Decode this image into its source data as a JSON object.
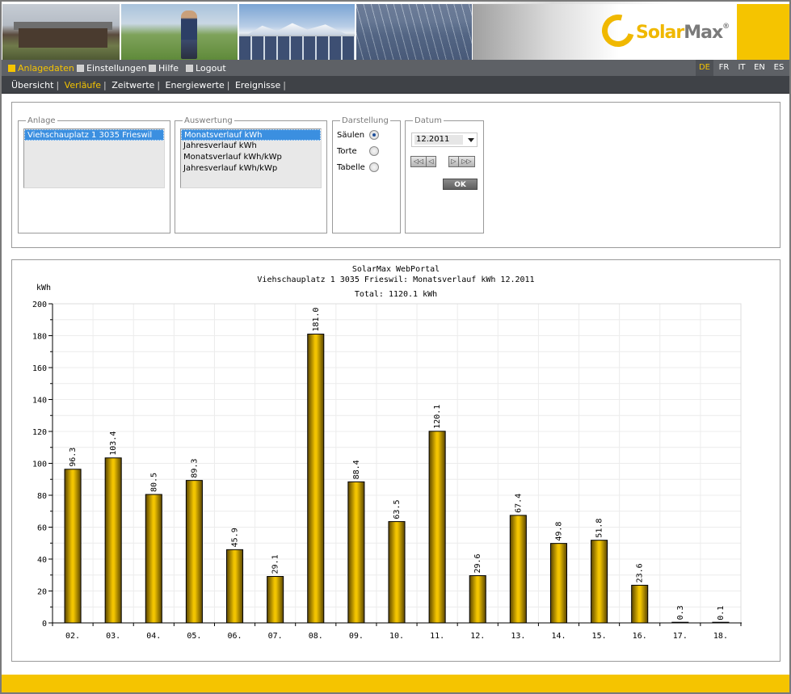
{
  "nav": {
    "main": [
      {
        "label": "Anlagedaten",
        "active": true
      },
      {
        "label": "Einstellungen",
        "active": false
      },
      {
        "label": "Hilfe",
        "active": false
      },
      {
        "label": "Logout",
        "active": false
      }
    ],
    "languages": [
      {
        "label": "DE",
        "active": true
      },
      {
        "label": "FR",
        "active": false
      },
      {
        "label": "IT",
        "active": false
      },
      {
        "label": "EN",
        "active": false
      },
      {
        "label": "ES",
        "active": false
      }
    ],
    "sub": [
      {
        "label": "Übersicht",
        "active": false
      },
      {
        "label": "Verläufe",
        "active": true
      },
      {
        "label": "Zeitwerte",
        "active": false
      },
      {
        "label": "Energiewerte",
        "active": false
      },
      {
        "label": "Ereignisse",
        "active": false
      }
    ]
  },
  "logo": {
    "brand_a": "Solar",
    "brand_b": "Max",
    "reg": "®"
  },
  "form": {
    "anlage": {
      "legend": "Anlage",
      "options": [
        "Viehschauplatz 1 3035 Frieswil"
      ],
      "selected": 0
    },
    "auswertung": {
      "legend": "Auswertung",
      "options": [
        "Monatsverlauf kWh",
        "Jahresverlauf kWh",
        "Monatsverlauf kWh/kWp",
        "Jahresverlauf kWh/kWp"
      ],
      "selected": 0
    },
    "darstellung": {
      "legend": "Darstellung",
      "options": [
        "Säulen",
        "Torte",
        "Tabelle"
      ],
      "selected": 0
    },
    "datum": {
      "legend": "Datum",
      "value": "12.2011",
      "first_label": "◁◁",
      "prev_label": "◁",
      "next_label": "▷",
      "last_label": "▷▷",
      "ok_label": "OK"
    }
  },
  "chart_data": {
    "type": "bar",
    "title": "SolarMax WebPortal",
    "subtitle": "Viehschauplatz 1 3035 Frieswil: Monatsverlauf kWh 12.2011",
    "total": "Total: 1120.1 kWh",
    "ylabel": "kWh",
    "xlabel": "",
    "ylim": [
      0,
      200
    ],
    "yticks": [
      0,
      20,
      40,
      60,
      80,
      100,
      120,
      140,
      160,
      180,
      200
    ],
    "grid": true,
    "categories": [
      "02.",
      "03.",
      "04.",
      "05.",
      "06.",
      "07.",
      "08.",
      "09.",
      "10.",
      "11.",
      "12.",
      "13.",
      "14.",
      "15.",
      "16.",
      "17.",
      "18."
    ],
    "values": [
      96.3,
      103.4,
      80.5,
      89.3,
      45.9,
      29.1,
      181.0,
      88.4,
      63.5,
      120.1,
      29.6,
      67.4,
      49.8,
      51.8,
      23.6,
      0.3,
      0.1
    ],
    "value_labels": [
      "96.3",
      "103.4",
      "80.5",
      "89.3",
      "45.9",
      "29.1",
      "181.0",
      "88.4",
      "63.5",
      "120.1",
      "29.6",
      "67.4",
      "49.8",
      "51.8",
      "23.6",
      "0.3",
      "0.1"
    ],
    "bar_color": "#e0b400"
  }
}
